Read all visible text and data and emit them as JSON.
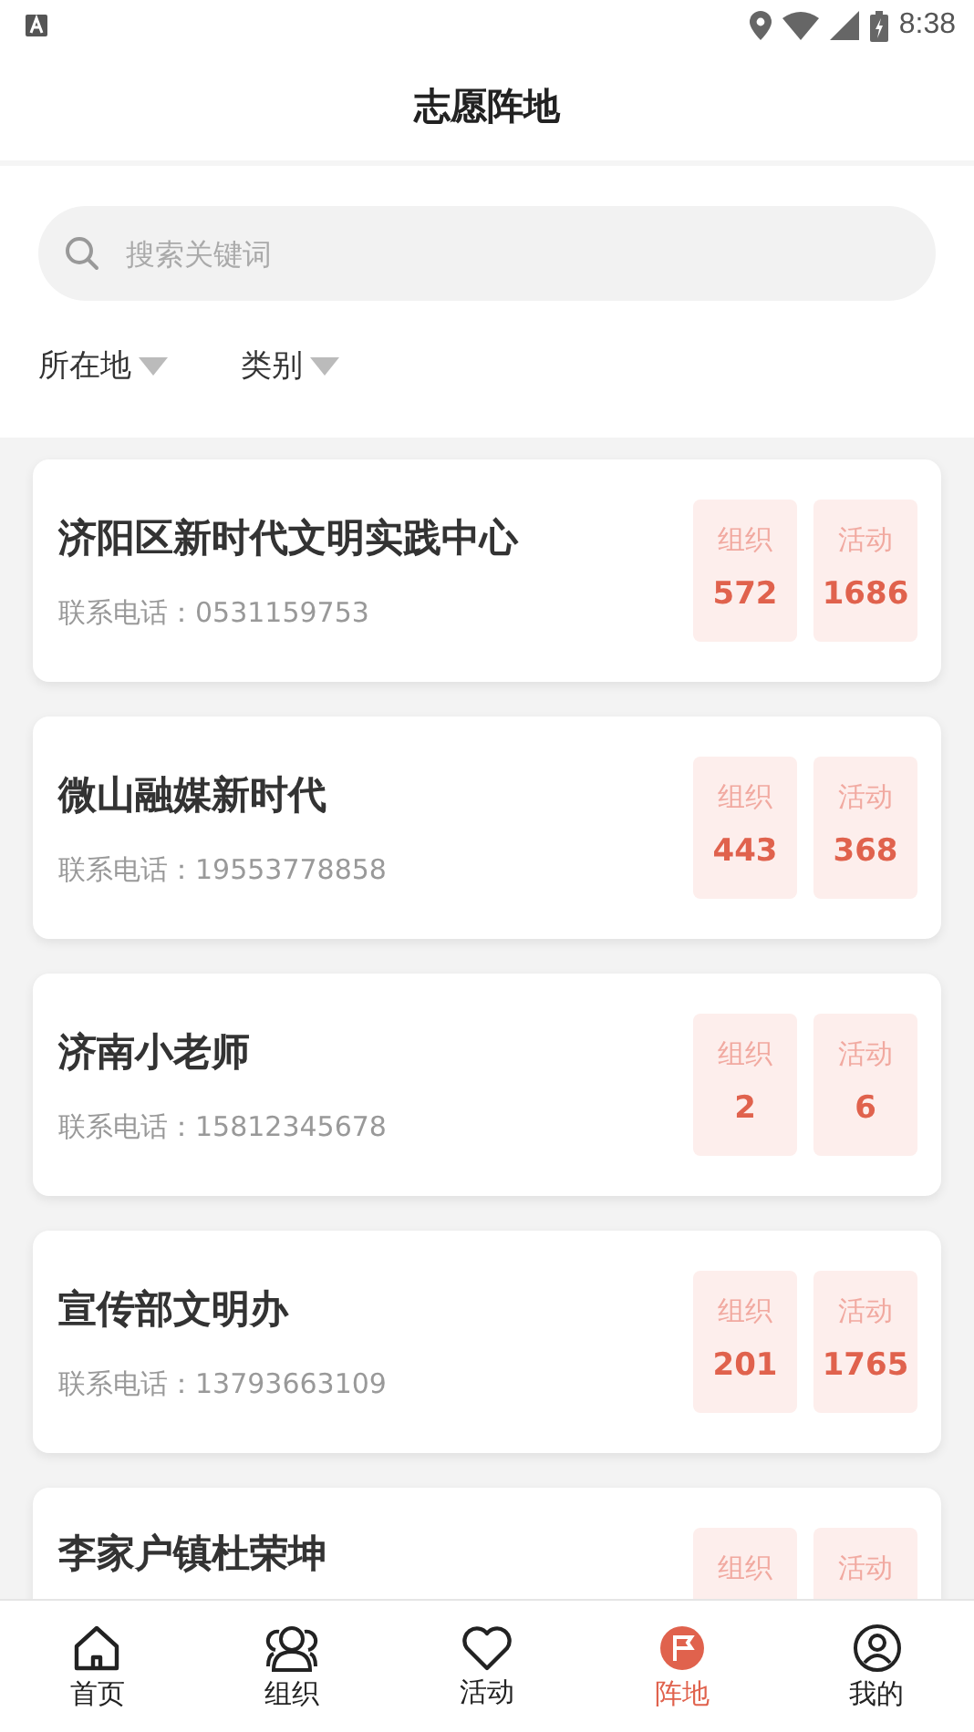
{
  "status_bar": {
    "time": "8:38"
  },
  "header": {
    "title": "志愿阵地"
  },
  "search": {
    "placeholder": "搜索关键词"
  },
  "filters": [
    {
      "label": "所在地"
    },
    {
      "label": "类别"
    }
  ],
  "cards": [
    {
      "name": "济阳区新时代文明实践中心",
      "phone": "联系电话：0531159753",
      "stats": [
        {
          "label": "组织",
          "value": "572"
        },
        {
          "label": "活动",
          "value": "1686"
        }
      ]
    },
    {
      "name": "微山融媒新时代",
      "phone": "联系电话：19553778858",
      "stats": [
        {
          "label": "组织",
          "value": "443"
        },
        {
          "label": "活动",
          "value": "368"
        }
      ]
    },
    {
      "name": "济南小老师",
      "phone": "联系电话：15812345678",
      "stats": [
        {
          "label": "组织",
          "value": "2"
        },
        {
          "label": "活动",
          "value": "6"
        }
      ]
    },
    {
      "name": "宣传部文明办",
      "phone": "联系电话：13793663109",
      "stats": [
        {
          "label": "组织",
          "value": "201"
        },
        {
          "label": "活动",
          "value": "1765"
        }
      ]
    },
    {
      "name": "李家户镇杜荣坤",
      "stats": [
        {
          "label": "组织"
        },
        {
          "label": "活动"
        }
      ]
    }
  ],
  "tab_bar": [
    {
      "kind": "home",
      "label": "首页",
      "selected": false
    },
    {
      "kind": "group",
      "label": "组织",
      "selected": false
    },
    {
      "kind": "heart",
      "label": "活动",
      "selected": false
    },
    {
      "kind": "flag",
      "label": "阵地",
      "selected": true
    },
    {
      "kind": "person",
      "label": "我的",
      "selected": false
    }
  ]
}
